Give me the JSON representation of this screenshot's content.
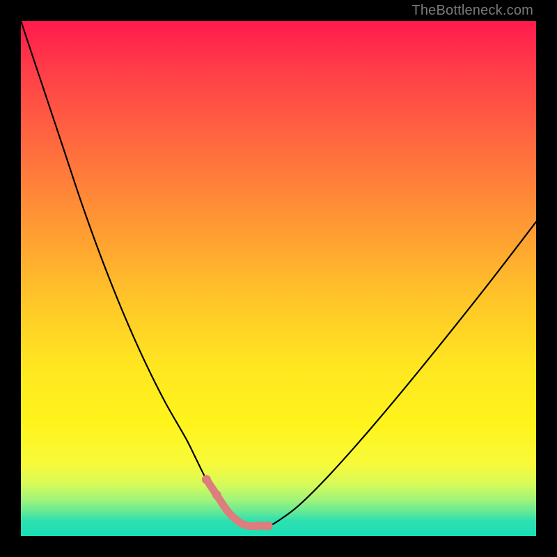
{
  "watermark": "TheBottleneck.com",
  "colors": {
    "curve_stroke": "#000000",
    "basin_stroke": "#dd7d7d",
    "frame_bg": "#000000"
  },
  "chart_data": {
    "type": "line",
    "title": "",
    "xlabel": "",
    "ylabel": "",
    "xlim": [
      0,
      100
    ],
    "ylim": [
      0,
      100
    ],
    "grid": false,
    "legend": false,
    "series": [
      {
        "name": "bottleneck-curve",
        "x": [
          0,
          4,
          8,
          12,
          16,
          20,
          24,
          28,
          32,
          34,
          36,
          38,
          40,
          42,
          44,
          46,
          48,
          50,
          54,
          60,
          68,
          78,
          90,
          100
        ],
        "y": [
          100,
          88,
          76,
          64,
          53,
          43,
          34,
          26,
          19,
          15,
          11,
          8,
          5,
          3,
          2,
          2,
          2,
          3,
          6,
          12,
          21,
          33,
          48,
          61
        ]
      },
      {
        "name": "basin-highlight",
        "x": [
          36,
          38,
          40,
          42,
          44,
          46,
          48
        ],
        "y": [
          11,
          8,
          5,
          3,
          2,
          2,
          2
        ]
      }
    ]
  }
}
